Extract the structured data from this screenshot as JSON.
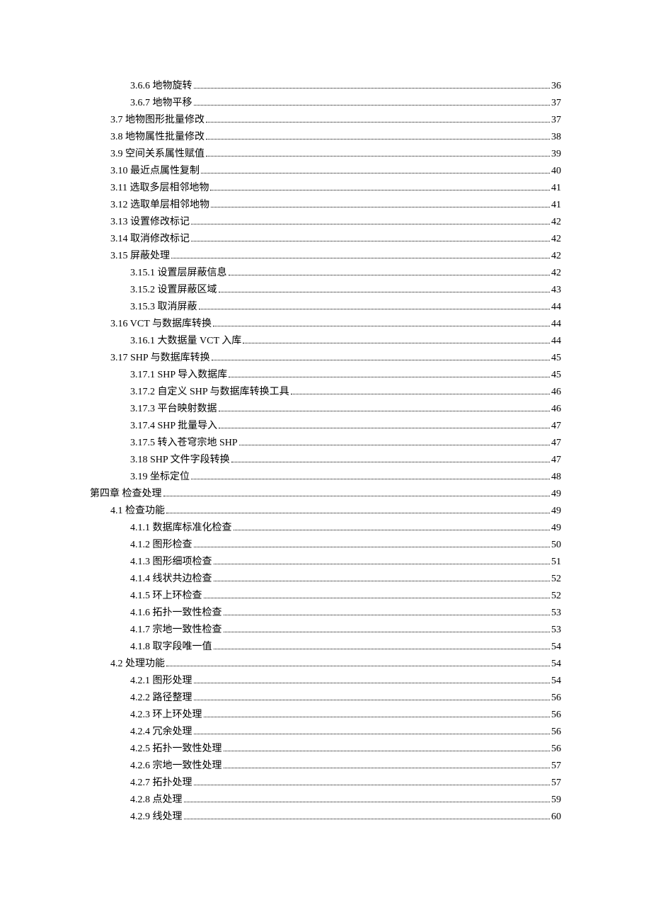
{
  "toc": [
    {
      "label": "3.6.6 地物旋转",
      "page": "36",
      "indent": 2
    },
    {
      "label": "3.6.7 地物平移",
      "page": "37",
      "indent": 2
    },
    {
      "label": "3.7 地物图形批量修改",
      "page": "37",
      "indent": 1
    },
    {
      "label": "3.8 地物属性批量修改",
      "page": "38",
      "indent": 1
    },
    {
      "label": "3.9 空间关系属性赋值",
      "page": "39",
      "indent": 1
    },
    {
      "label": "3.10 最近点属性复制",
      "page": "40",
      "indent": 1
    },
    {
      "label": "3.11 选取多层相邻地物",
      "page": "41",
      "indent": 1
    },
    {
      "label": "3.12 选取单层相邻地物",
      "page": "41",
      "indent": 1
    },
    {
      "label": "3.13 设置修改标记",
      "page": "42",
      "indent": 1
    },
    {
      "label": "3.14 取消修改标记",
      "page": "42",
      "indent": 1
    },
    {
      "label": "3.15 屏蔽处理",
      "page": "42",
      "indent": 1
    },
    {
      "label": "3.15.1 设置层屏蔽信息",
      "page": "42",
      "indent": 2
    },
    {
      "label": "3.15.2 设置屏蔽区域",
      "page": "43",
      "indent": 2
    },
    {
      "label": "3.15.3 取消屏蔽",
      "page": "44",
      "indent": 2
    },
    {
      "label": "3.16 VCT 与数据库转换",
      "page": "44",
      "indent": 1
    },
    {
      "label": "3.16.1 大数据量 VCT 入库",
      "page": "44",
      "indent": 2
    },
    {
      "label": "3.17 SHP 与数据库转换",
      "page": "45",
      "indent": 1
    },
    {
      "label": "3.17.1 SHP 导入数据库",
      "page": "45",
      "indent": 2
    },
    {
      "label": "3.17.2 自定义 SHP 与数据库转换工具",
      "page": "46",
      "indent": 2
    },
    {
      "label": "3.17.3 平台映射数据",
      "page": "46",
      "indent": 2
    },
    {
      "label": "3.17.4 SHP 批量导入",
      "page": "47",
      "indent": 2
    },
    {
      "label": "3.17.5 转入苍穹宗地 SHP",
      "page": "47",
      "indent": 2
    },
    {
      "label": "3.18 SHP 文件字段转换",
      "page": "47",
      "indent": 2
    },
    {
      "label": "3.19 坐标定位",
      "page": "48",
      "indent": 2
    },
    {
      "label": "第四章 检查处理",
      "page": "49",
      "indent": 0
    },
    {
      "label": "4.1 检查功能",
      "page": "49",
      "indent": 1
    },
    {
      "label": "4.1.1 数据库标准化检查",
      "page": "49",
      "indent": 2
    },
    {
      "label": "4.1.2 图形检查",
      "page": "50",
      "indent": 2
    },
    {
      "label": "4.1.3 图形细项检查",
      "page": "51",
      "indent": 2
    },
    {
      "label": "4.1.4 线状共边检查",
      "page": "52",
      "indent": 2
    },
    {
      "label": "4.1.5 环上环检查",
      "page": "52",
      "indent": 2
    },
    {
      "label": "4.1.6 拓扑一致性检查",
      "page": "53",
      "indent": 2
    },
    {
      "label": "4.1.7 宗地一致性检查",
      "page": "53",
      "indent": 2
    },
    {
      "label": "4.1.8 取字段唯一值",
      "page": "54",
      "indent": 2
    },
    {
      "label": "4.2 处理功能",
      "page": "54",
      "indent": 1
    },
    {
      "label": "4.2.1 图形处理",
      "page": "54",
      "indent": 2
    },
    {
      "label": "4.2.2 路径整理",
      "page": "56",
      "indent": 2
    },
    {
      "label": "4.2.3 环上环处理",
      "page": "56",
      "indent": 2
    },
    {
      "label": "4.2.4 冗余处理",
      "page": "56",
      "indent": 2
    },
    {
      "label": "4.2.5 拓扑一致性处理",
      "page": "56",
      "indent": 2
    },
    {
      "label": "4.2.6 宗地一致性处理",
      "page": "57",
      "indent": 2
    },
    {
      "label": "4.2.7 拓扑处理",
      "page": "57",
      "indent": 2
    },
    {
      "label": "4.2.8 点处理",
      "page": "59",
      "indent": 2
    },
    {
      "label": "4.2.9 线处理",
      "page": "60",
      "indent": 2
    }
  ]
}
